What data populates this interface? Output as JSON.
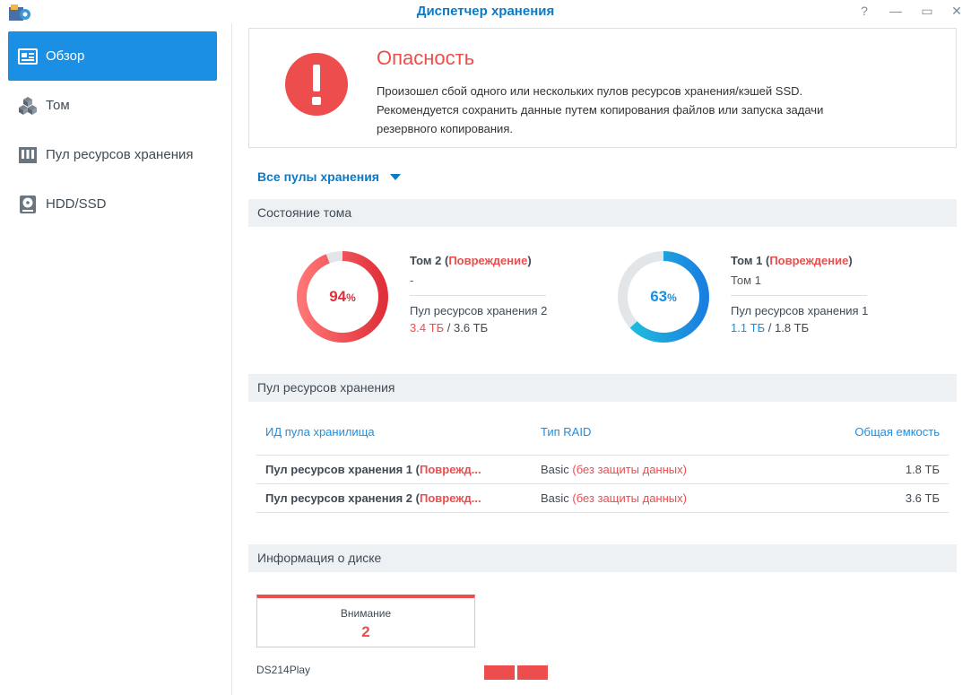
{
  "window": {
    "title": "Диспетчер хранения",
    "help_icon": "?",
    "minimize_icon": "—",
    "maximize_icon": "▭",
    "close_icon": "✕"
  },
  "sidebar": {
    "items": [
      {
        "label": "Обзор",
        "icon": "overview-icon",
        "active": true
      },
      {
        "label": "Том",
        "icon": "cubes-icon",
        "active": false
      },
      {
        "label": "Пул ресурсов хранения",
        "icon": "storage-pool-icon",
        "active": false
      },
      {
        "label": "HDD/SSD",
        "icon": "disk-icon",
        "active": false
      }
    ]
  },
  "alert": {
    "title": "Опасность",
    "line1": "Произошел сбой одного или нескольких пулов ресурсов хранения/кэшей SSD.",
    "line2": "Рекомендуется сохранить данные путем копирования файлов или запуска задачи",
    "line3": "резервного копирования."
  },
  "pool_filter": {
    "selected": "Все пулы хранения"
  },
  "volume_status": {
    "header": "Состояние тома",
    "volumes": [
      {
        "name": "Том 2",
        "status": "Повреждение",
        "description": "-",
        "pool": "Пул ресурсов хранения 2",
        "used": "3.4 ТБ",
        "separator": " / ",
        "total": "3.6 ТБ",
        "percent": 94,
        "percent_sign": "%",
        "color": "#ee4d4d"
      },
      {
        "name": "Том 1",
        "status": "Повреждение",
        "description": "Том 1",
        "pool": "Пул ресурсов хранения 1",
        "used": "1.1 ТБ",
        "separator": " / ",
        "total": "1.8 ТБ",
        "percent": 63,
        "percent_sign": "%",
        "color": "#1a8fe3"
      }
    ]
  },
  "storage_pool": {
    "header": "Пул ресурсов хранения",
    "columns": [
      "ИД пула хранилища",
      "Тип RAID",
      "Общая емкость"
    ],
    "rows": [
      {
        "name": "Пул ресурсов хранения 1",
        "status": "Поврежд...",
        "raid": "Basic",
        "raid_note": "(без защиты данных)",
        "capacity": "1.8 ТБ"
      },
      {
        "name": "Пул ресурсов хранения 2",
        "status": "Поврежд...",
        "raid": "Basic",
        "raid_note": "(без защиты данных)",
        "capacity": "3.6 ТБ"
      }
    ]
  },
  "disk_info": {
    "header": "Информация о диске",
    "card_label": "Внимание",
    "card_count": "2",
    "model": "DS214Play"
  },
  "colors": {
    "accent": "#1a8fe3",
    "danger": "#ee4d4d",
    "track": "#e3e6e9"
  }
}
